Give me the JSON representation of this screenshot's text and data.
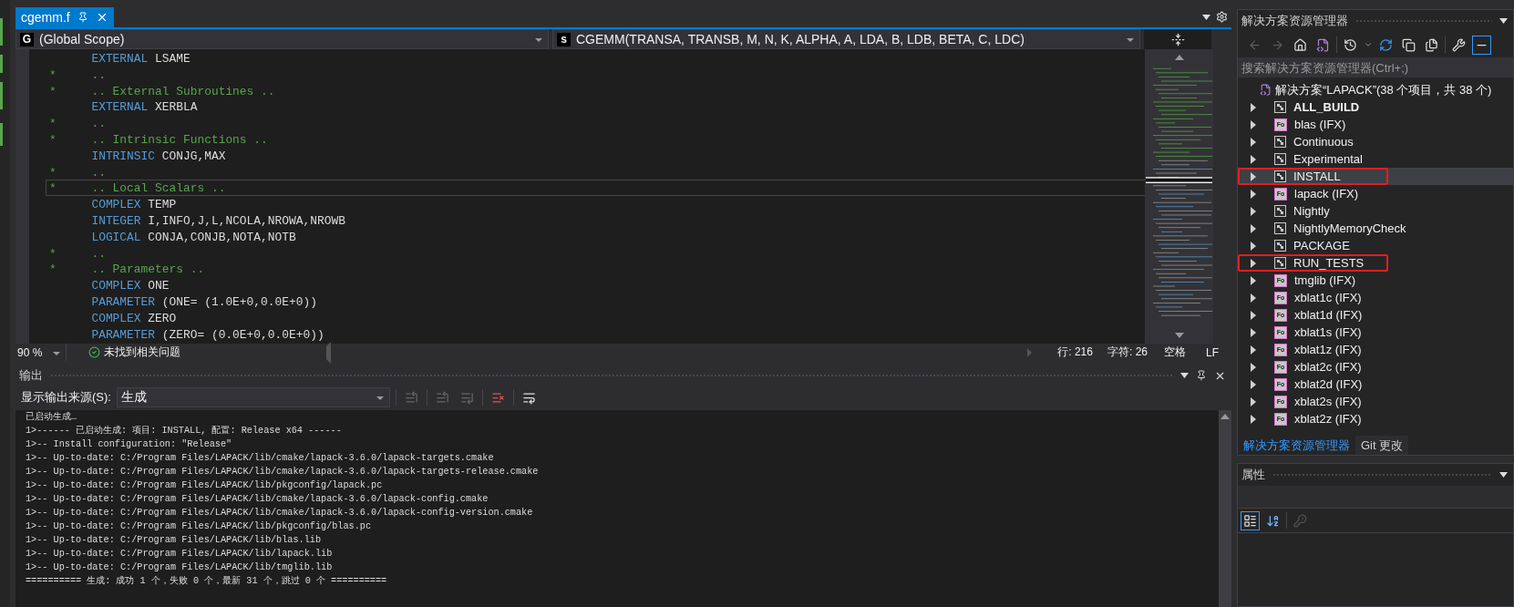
{
  "editor": {
    "tab": {
      "title": "cgemm.f",
      "selected": true
    },
    "scope": {
      "badge": "G",
      "value": "(Global Scope)"
    },
    "member": {
      "badge": "s",
      "value": "CGEMM(TRANSA, TRANSB, M, N, K, ALPHA, A, LDA, B, LDB, BETA, C, LDC)"
    },
    "lines": [
      {
        "kind": "code",
        "keyword": "EXTERNAL",
        "text": "LSAME",
        "current": false
      },
      {
        "kind": "comment",
        "marker": "*",
        "text": "..",
        "current": false
      },
      {
        "kind": "comment",
        "marker": "*",
        "text": ".. External Subroutines ..",
        "current": false
      },
      {
        "kind": "code",
        "keyword": "EXTERNAL",
        "text": "XERBLA",
        "current": false
      },
      {
        "kind": "comment",
        "marker": "*",
        "text": "..",
        "current": false
      },
      {
        "kind": "comment",
        "marker": "*",
        "text": ".. Intrinsic Functions ..",
        "current": false
      },
      {
        "kind": "code",
        "keyword": "INTRINSIC",
        "text": "CONJG,MAX",
        "current": false
      },
      {
        "kind": "comment",
        "marker": "*",
        "text": "..",
        "current": false
      },
      {
        "kind": "comment",
        "marker": "*",
        "text": ".. Local Scalars ..",
        "current": true
      },
      {
        "kind": "code",
        "keyword": "COMPLEX",
        "text": "TEMP",
        "current": false
      },
      {
        "kind": "code",
        "keyword": "INTEGER",
        "text": "I,INFO,J,L,NCOLA,NROWA,NROWB",
        "current": false
      },
      {
        "kind": "code",
        "keyword": "LOGICAL",
        "text": "CONJA,CONJB,NOTA,NOTB",
        "current": false
      },
      {
        "kind": "comment",
        "marker": "*",
        "text": "..",
        "current": false
      },
      {
        "kind": "comment",
        "marker": "*",
        "text": ".. Parameters ..",
        "current": false
      },
      {
        "kind": "code",
        "keyword": "COMPLEX",
        "text": "ONE",
        "current": false
      },
      {
        "kind": "code",
        "keyword": "PARAMETER",
        "text": "(ONE= (1.0E+0,0.0E+0))",
        "current": false
      },
      {
        "kind": "code",
        "keyword": "COMPLEX",
        "text": "ZERO",
        "current": false
      },
      {
        "kind": "code",
        "keyword": "PARAMETER",
        "text": "(ZERO= (0.0E+0,0.0E+0))",
        "current": false
      }
    ],
    "status_bar": {
      "zoom": "90 %",
      "issues": "未找到相关问题",
      "line": "行: 216",
      "column": "字符: 26",
      "indent": "空格",
      "line_ending": "LF"
    }
  },
  "output": {
    "title": "输出",
    "source_label": "显示输出来源(S):",
    "source": "生成",
    "toolbar": [
      {
        "kind": "go-to",
        "disabled": true
      },
      {
        "kind": "previous",
        "disabled": true
      },
      {
        "kind": "next",
        "disabled": true
      },
      {
        "kind": "clear",
        "disabled": false
      },
      {
        "kind": "wrap",
        "disabled": false
      }
    ],
    "lines": [
      "已启动生成…",
      "1>------ 已启动生成: 项目: INSTALL, 配置: Release x64 ------",
      "1>-- Install configuration: \"Release\"",
      "1>-- Up-to-date: C:/Program Files/LAPACK/lib/cmake/lapack-3.6.0/lapack-targets.cmake",
      "1>-- Up-to-date: C:/Program Files/LAPACK/lib/cmake/lapack-3.6.0/lapack-targets-release.cmake",
      "1>-- Up-to-date: C:/Program Files/LAPACK/lib/pkgconfig/lapack.pc",
      "1>-- Up-to-date: C:/Program Files/LAPACK/lib/cmake/lapack-3.6.0/lapack-config.cmake",
      "1>-- Up-to-date: C:/Program Files/LAPACK/lib/cmake/lapack-3.6.0/lapack-config-version.cmake",
      "1>-- Up-to-date: C:/Program Files/LAPACK/lib/pkgconfig/blas.pc",
      "1>-- Up-to-date: C:/Program Files/LAPACK/lib/blas.lib",
      "1>-- Up-to-date: C:/Program Files/LAPACK/lib/lapack.lib",
      "1>-- Up-to-date: C:/Program Files/LAPACK/lib/tmglib.lib",
      "========== 生成: 成功 1 个，失败 0 个，最新 31 个，跳过 0 个 =========="
    ]
  },
  "solution_explorer": {
    "title": "解决方案资源管理器",
    "toolbar": [
      {
        "kind": "back",
        "disabled": true,
        "selected": false
      },
      {
        "kind": "forward",
        "disabled": true,
        "selected": false
      },
      {
        "kind": "home",
        "disabled": false,
        "selected": false
      },
      {
        "kind": "switch-views",
        "disabled": false,
        "selected": false
      },
      {
        "kind": "history",
        "disabled": false,
        "selected": false
      },
      {
        "kind": "refresh",
        "disabled": false,
        "selected": false
      },
      {
        "kind": "collapse",
        "disabled": false,
        "selected": false
      },
      {
        "kind": "show-all",
        "disabled": false,
        "selected": false
      },
      {
        "kind": "properties",
        "disabled": false,
        "selected": false
      },
      {
        "kind": "preview",
        "disabled": false,
        "selected": true
      }
    ],
    "search": {
      "placeholder": "搜索解决方案资源管理器(Ctrl+;)"
    },
    "solution": "解决方案“LAPACK”(38 个项目，共 38 个)",
    "items": [
      {
        "label": "ALL_BUILD",
        "kind": "target",
        "bold": true,
        "selected": false,
        "annotated": false
      },
      {
        "label": "blas (IFX)",
        "kind": "fortran",
        "badge": "Fo",
        "bold": false,
        "selected": false,
        "annotated": false
      },
      {
        "label": "Continuous",
        "kind": "target",
        "bold": false,
        "selected": false,
        "annotated": false
      },
      {
        "label": "Experimental",
        "kind": "target",
        "bold": false,
        "selected": false,
        "annotated": false
      },
      {
        "label": "INSTALL",
        "kind": "target",
        "bold": false,
        "selected": true,
        "annotated": true
      },
      {
        "label": "lapack (IFX)",
        "kind": "fortran",
        "badge": "Fo",
        "bold": false,
        "selected": false,
        "annotated": false
      },
      {
        "label": "Nightly",
        "kind": "target",
        "bold": false,
        "selected": false,
        "annotated": false
      },
      {
        "label": "NightlyMemoryCheck",
        "kind": "target",
        "bold": false,
        "selected": false,
        "annotated": false
      },
      {
        "label": "PACKAGE",
        "kind": "target",
        "bold": false,
        "selected": false,
        "annotated": false
      },
      {
        "label": "RUN_TESTS",
        "kind": "target",
        "bold": false,
        "selected": false,
        "annotated": true
      },
      {
        "label": "tmglib (IFX)",
        "kind": "fortran",
        "badge": "Fo",
        "bold": false,
        "selected": false,
        "annotated": false
      },
      {
        "label": "xblat1c (IFX)",
        "kind": "fortran",
        "badge": "Fo",
        "bold": false,
        "selected": false,
        "annotated": false
      },
      {
        "label": "xblat1d (IFX)",
        "kind": "fortran",
        "badge": "Fo",
        "bold": false,
        "selected": false,
        "annotated": false
      },
      {
        "label": "xblat1s (IFX)",
        "kind": "fortran",
        "badge": "Fo",
        "bold": false,
        "selected": false,
        "annotated": false
      },
      {
        "label": "xblat1z (IFX)",
        "kind": "fortran",
        "badge": "Fo",
        "bold": false,
        "selected": false,
        "annotated": false
      },
      {
        "label": "xblat2c (IFX)",
        "kind": "fortran",
        "badge": "Fo",
        "bold": false,
        "selected": false,
        "annotated": false
      },
      {
        "label": "xblat2d (IFX)",
        "kind": "fortran",
        "badge": "Fo",
        "bold": false,
        "selected": false,
        "annotated": false
      },
      {
        "label": "xblat2s (IFX)",
        "kind": "fortran",
        "badge": "Fo",
        "bold": false,
        "selected": false,
        "annotated": false
      },
      {
        "label": "xblat2z (IFX)",
        "kind": "fortran",
        "badge": "Fo",
        "bold": false,
        "selected": false,
        "annotated": false
      }
    ],
    "tabs": [
      {
        "label": "解决方案资源管理器",
        "selected": true
      },
      {
        "label": "Git 更改",
        "selected": false
      }
    ]
  },
  "properties": {
    "title": "属性",
    "toolbar": [
      {
        "kind": "categorized",
        "disabled": false,
        "selected": true
      },
      {
        "kind": "alphabetical",
        "disabled": false,
        "selected": false
      },
      {
        "kind": "property-pages",
        "disabled": true,
        "selected": false
      }
    ]
  }
}
